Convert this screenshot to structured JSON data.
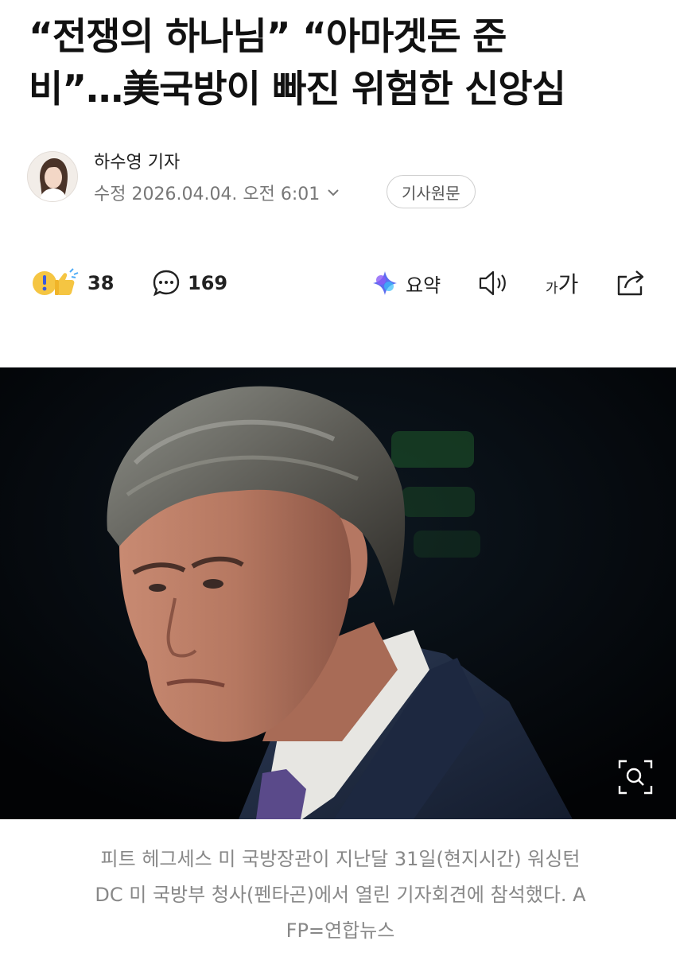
{
  "article": {
    "title_line1": "“전쟁의 하나님” “아마겟돈 준",
    "title_line2": "비”…美국방이 빠진 위험한 신앙심"
  },
  "byline": {
    "author": "하수영 기자",
    "modified": "수정 2026.04.04. 오전 6:01",
    "source_button": "기사원문"
  },
  "actions": {
    "reactions_count": "38",
    "comments_count": "169",
    "summary_label": "요약",
    "font_small": "가",
    "font_large": "가"
  },
  "photo": {
    "caption_line1": "피트 헤그세스 미 국방장관이 지난달 31일(현지시간) 워싱턴",
    "caption_line2": "DC 미 국방부 청사(펜타곤)에서 열린 기자회견에 참석했다. A",
    "caption_line3": "FP=연합뉴스"
  },
  "colors": {
    "summary_icon": "#5b6cf0",
    "reaction_icon": "#f5c542"
  }
}
